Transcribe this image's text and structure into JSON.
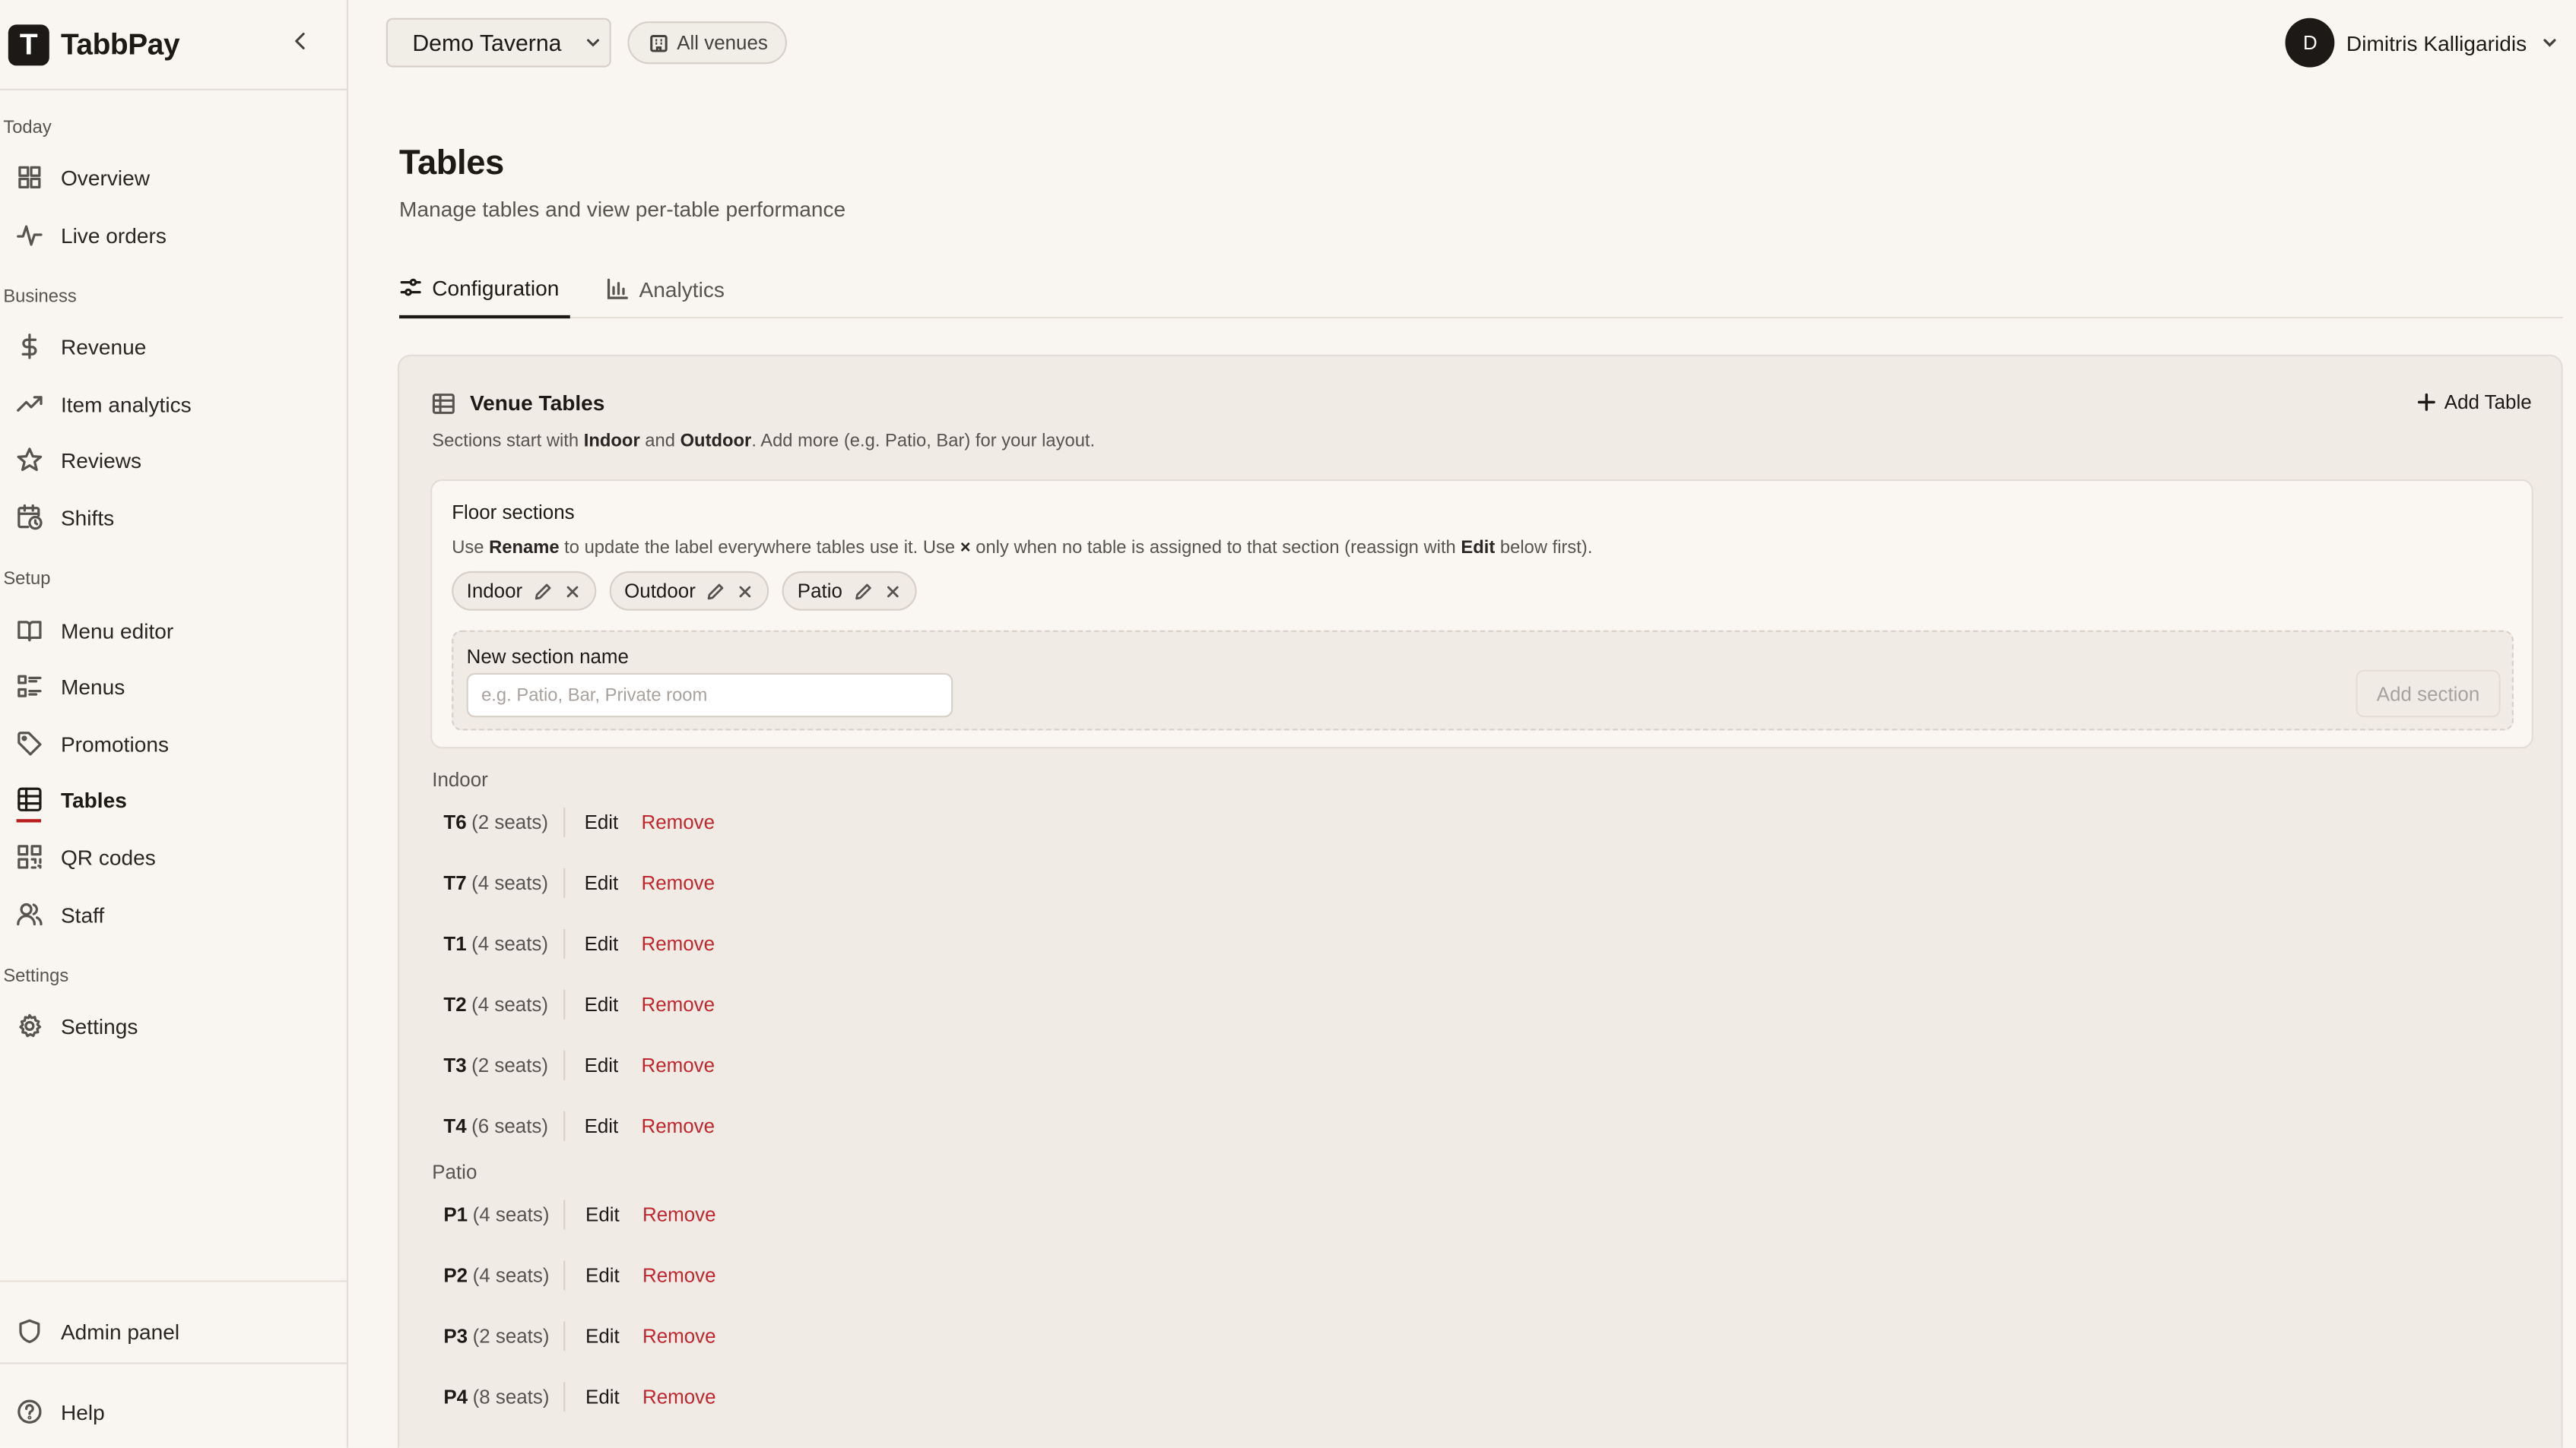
{
  "brand": {
    "name": "TabbPay",
    "logo_letter": "T"
  },
  "sidebar": {
    "sections": [
      {
        "label": "Today"
      },
      {
        "label": "Business"
      },
      {
        "label": "Setup"
      },
      {
        "label": "Settings"
      }
    ],
    "items": [
      {
        "label": "Overview",
        "icon": "grid-icon"
      },
      {
        "label": "Live orders",
        "icon": "activity-icon"
      },
      {
        "label": "Revenue",
        "icon": "dollar-icon"
      },
      {
        "label": "Item analytics",
        "icon": "trending-up-icon"
      },
      {
        "label": "Reviews",
        "icon": "star-icon"
      },
      {
        "label": "Shifts",
        "icon": "calendar-clock-icon"
      },
      {
        "label": "Menu editor",
        "icon": "book-icon"
      },
      {
        "label": "Menus",
        "icon": "list-icon"
      },
      {
        "label": "Promotions",
        "icon": "tag-icon"
      },
      {
        "label": "Tables",
        "icon": "table-icon",
        "active": true
      },
      {
        "label": "QR codes",
        "icon": "qr-icon"
      },
      {
        "label": "Staff",
        "icon": "users-icon"
      },
      {
        "label": "Settings",
        "icon": "gear-icon"
      },
      {
        "label": "Admin panel",
        "icon": "shield-icon"
      },
      {
        "label": "Help",
        "icon": "help-icon"
      }
    ]
  },
  "topbar": {
    "venue": "Demo Taverna",
    "all_venues": "All venues",
    "user_initial": "D",
    "user_name": "Dimitris Kalligaridis"
  },
  "page": {
    "title": "Tables",
    "subtitle": "Manage tables and view per-table performance",
    "tabs": [
      {
        "label": "Configuration",
        "active": true
      },
      {
        "label": "Analytics"
      }
    ]
  },
  "card": {
    "title": "Venue Tables",
    "add_table": "Add Table",
    "desc_1": "Sections start with ",
    "desc_indoor": "Indoor",
    "desc_2": " and ",
    "desc_outdoor": "Outdoor",
    "desc_3": ". Add more (e.g. Patio, Bar) for your layout."
  },
  "floor": {
    "title": "Floor sections",
    "desc_1": "Use ",
    "desc_rename": "Rename",
    "desc_2": " to update the label everywhere tables use it. Use ",
    "desc_x": "×",
    "desc_3": " only when no table is assigned to that section (reassign with ",
    "desc_edit": "Edit",
    "desc_4": " below first).",
    "chips": [
      "Indoor",
      "Outdoor",
      "Patio"
    ],
    "new_section_label": "New section name",
    "new_section_placeholder": "e.g. Patio, Bar, Private room",
    "add_section": "Add section"
  },
  "groups": [
    {
      "label": "Indoor",
      "tables": [
        {
          "name": "T6",
          "seats": "(2 seats)"
        },
        {
          "name": "T7",
          "seats": "(4 seats)"
        },
        {
          "name": "T1",
          "seats": "(4 seats)"
        },
        {
          "name": "T2",
          "seats": "(4 seats)"
        },
        {
          "name": "T3",
          "seats": "(2 seats)"
        },
        {
          "name": "T4",
          "seats": "(6 seats)"
        }
      ]
    },
    {
      "label": "Patio",
      "tables": [
        {
          "name": "P1",
          "seats": "(4 seats)"
        },
        {
          "name": "P2",
          "seats": "(4 seats)"
        },
        {
          "name": "P3",
          "seats": "(2 seats)"
        },
        {
          "name": "P4",
          "seats": "(8 seats)"
        }
      ]
    }
  ],
  "row_actions": {
    "edit": "Edit",
    "remove": "Remove"
  }
}
